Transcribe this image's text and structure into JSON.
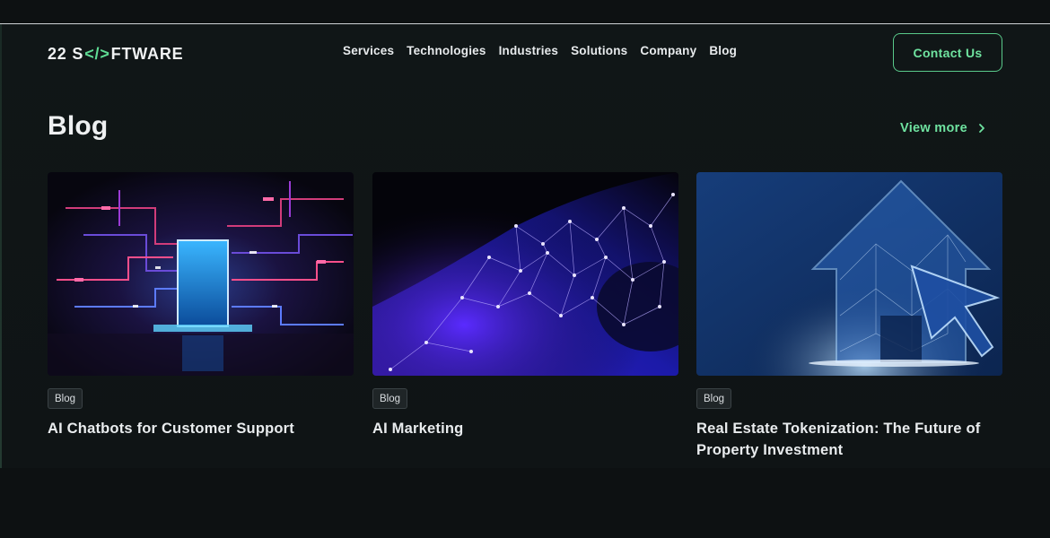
{
  "brand": {
    "logo_prefix": "22 S",
    "logo_code": "</>",
    "logo_suffix": "FTWARE",
    "accent_color": "#6fe3a0"
  },
  "nav": {
    "items": [
      "Services",
      "Technologies",
      "Industries",
      "Solutions",
      "Company",
      "Blog"
    ]
  },
  "header": {
    "contact_label": "Contact Us"
  },
  "section": {
    "title": "Blog",
    "view_more_label": "View more",
    "view_more_icon": "chevron-right-icon"
  },
  "cards": [
    {
      "tag": "Blog",
      "title": "AI Chatbots for Customer Support",
      "image_theme": "neon-circuit-portal"
    },
    {
      "tag": "Blog",
      "title": "AI Marketing",
      "image_theme": "purple-network-mesh"
    },
    {
      "tag": "Blog",
      "title": "Real Estate Tokenization: The Future of Property Investment",
      "image_theme": "blue-house-cursor"
    }
  ]
}
